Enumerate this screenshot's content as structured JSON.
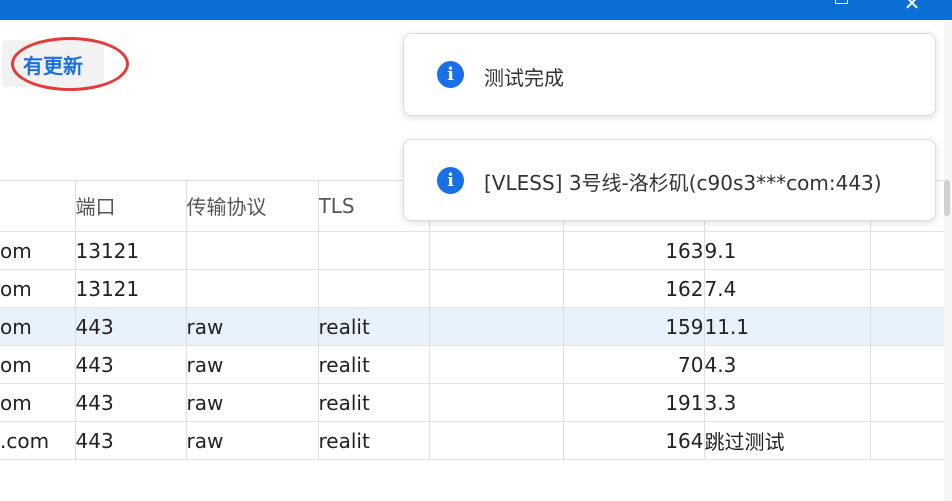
{
  "titlebar": {
    "maximize_icon": "maximize-icon",
    "close_icon": "close-icon",
    "close_glyph": "✕",
    "accent_color": "#0a6fd4"
  },
  "update_button": {
    "label": "有更新",
    "highlight_color": "#e33b3b"
  },
  "toasts": [
    {
      "icon": "info-icon",
      "glyph": "i",
      "text": "测试完成"
    },
    {
      "icon": "info-icon",
      "glyph": "i",
      "text": "[VLESS] 3号线-洛杉矶(c90s3***com:443)"
    }
  ],
  "table": {
    "headers": [
      "",
      "端口",
      "传输协议",
      "TLS",
      "",
      "",
      "",
      ""
    ],
    "rows": [
      [
        "om",
        "13121",
        "",
        "",
        "",
        "163",
        "9.1",
        ""
      ],
      [
        "om",
        "13121",
        "",
        "",
        "",
        "162",
        "7.4",
        ""
      ],
      [
        "om",
        "443",
        "raw",
        "realit",
        "",
        "159",
        "11.1",
        ""
      ],
      [
        "om",
        "443",
        "raw",
        "realit",
        "",
        "70",
        "4.3",
        ""
      ],
      [
        "om",
        "443",
        "raw",
        "realit",
        "",
        "191",
        "3.3",
        ""
      ],
      [
        ".com",
        "443",
        "raw",
        "realit",
        "",
        "164",
        "跳过测试",
        ""
      ]
    ],
    "selected_row": 2,
    "latency_color": "#1e8a2e"
  }
}
